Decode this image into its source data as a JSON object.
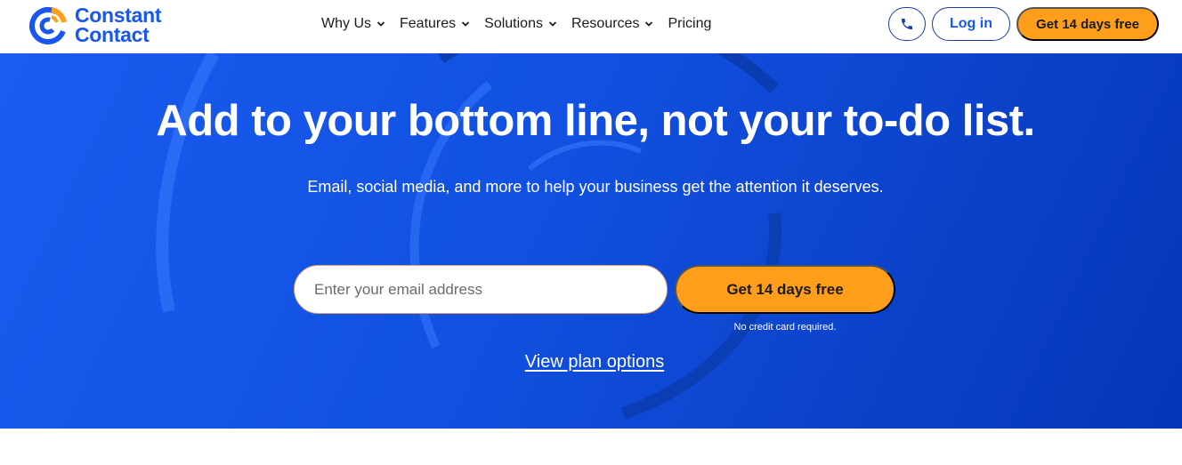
{
  "brand": {
    "name_line1": "Constant",
    "name_line2": "Contact",
    "color": "#1856ed"
  },
  "nav": {
    "items": [
      {
        "label": "Why Us",
        "has_dropdown": true
      },
      {
        "label": "Features",
        "has_dropdown": true
      },
      {
        "label": "Solutions",
        "has_dropdown": true
      },
      {
        "label": "Resources",
        "has_dropdown": true
      },
      {
        "label": "Pricing",
        "has_dropdown": false
      }
    ]
  },
  "header_actions": {
    "phone_icon": "phone-icon",
    "login_label": "Log in",
    "trial_label": "Get 14 days free",
    "trial_color": "#ff9e1b"
  },
  "hero": {
    "title": "Add to your bottom line, not your to-do list.",
    "subtitle": "Email, social media, and more to help your business get the attention it deserves.",
    "email_placeholder": "Enter your email address",
    "cta_label": "Get 14 days free",
    "cta_note": "No credit card required.",
    "plans_link": "View plan options",
    "background_color": "#1150e0"
  }
}
